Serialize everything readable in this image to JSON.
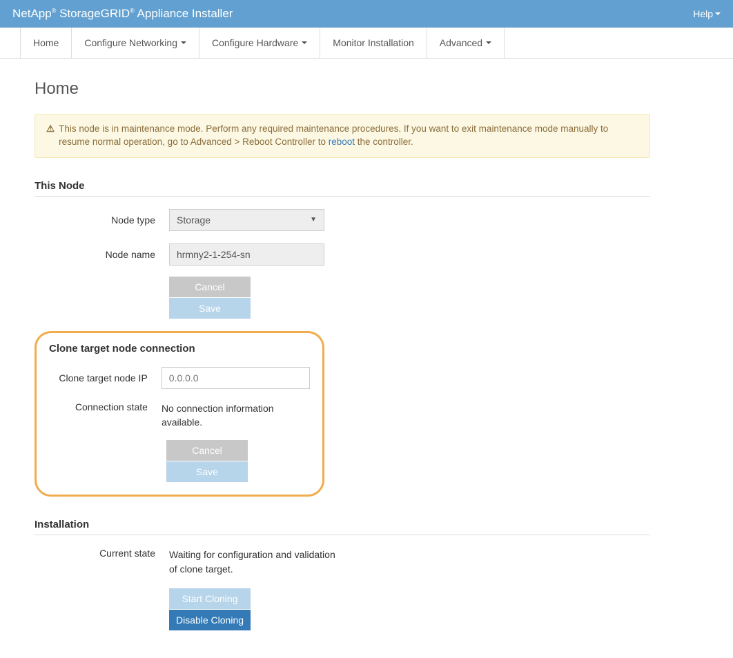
{
  "header": {
    "brand_prefix": "NetApp",
    "brand_mid": " StorageGRID",
    "brand_suffix": " Appliance Installer",
    "help": "Help"
  },
  "nav": {
    "home": "Home",
    "configure_networking": "Configure Networking",
    "configure_hardware": "Configure Hardware",
    "monitor_installation": "Monitor Installation",
    "advanced": "Advanced"
  },
  "page_title": "Home",
  "alert": {
    "text_before": "This node is in maintenance mode. Perform any required maintenance procedures. If you want to exit maintenance mode manually to resume normal operation, go to Advanced > Reboot Controller to ",
    "link": "reboot",
    "text_after": " the controller."
  },
  "this_node": {
    "title": "This Node",
    "node_type_label": "Node type",
    "node_type_value": "Storage",
    "node_name_label": "Node name",
    "node_name_value": "hrmny2-1-254-sn",
    "cancel": "Cancel",
    "save": "Save"
  },
  "clone": {
    "title": "Clone target node connection",
    "ip_label": "Clone target node IP",
    "ip_placeholder": "0.0.0.0",
    "state_label": "Connection state",
    "state_value": "No connection information available.",
    "cancel": "Cancel",
    "save": "Save"
  },
  "installation": {
    "title": "Installation",
    "state_label": "Current state",
    "state_value": "Waiting for configuration and validation of clone target.",
    "start_cloning": "Start Cloning",
    "disable_cloning": "Disable Cloning"
  }
}
